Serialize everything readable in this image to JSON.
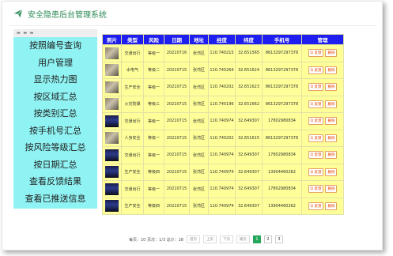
{
  "app": {
    "title": "安全隐患后台管理系统",
    "icon": "paper-plane-icon",
    "accent": "#2e8b57"
  },
  "sidebar": {
    "menu_icon": "menu-icon",
    "items": [
      "按照编号查询",
      "用户管理",
      "显示热力图",
      "按区域汇总",
      "按类别汇总",
      "按手机号汇总",
      "按风险等级汇总",
      "按日期汇总",
      "查看反馈结果",
      "查看已推送信息"
    ]
  },
  "table": {
    "headers": [
      "照片",
      "类型",
      "风险",
      "日期",
      "地址",
      "经度",
      "纬度",
      "手机号",
      "管理"
    ],
    "rows": [
      {
        "photo": "photo-default",
        "type": "交通出行",
        "risk": "等级一",
        "date": "20210716",
        "addr": "张湾区",
        "lng": "110.740215",
        "lat": "32.651565",
        "phone": "8613297297378"
      },
      {
        "photo": "photo-default",
        "type": "水电气",
        "risk": "等级二",
        "date": "20210715",
        "addr": "张湾区",
        "lng": "110.740264",
        "lat": "32.651624",
        "phone": "8613297297378"
      },
      {
        "photo": "photo-default",
        "type": "生产安全",
        "risk": "等级一",
        "date": "20210715",
        "addr": "张湾区",
        "lng": "110.740202",
        "lat": "32.651623",
        "phone": "8613297297378"
      },
      {
        "photo": "photo-default",
        "type": "火灾防爆",
        "risk": "等级三",
        "date": "20210715",
        "addr": "张湾区",
        "lng": "110.740196",
        "lat": "32.651662",
        "phone": "8613297297378"
      },
      {
        "photo": "photo-dark",
        "type": "交通出行",
        "risk": "等级一",
        "date": "20210715",
        "addr": "张湾区",
        "lng": "110.740974",
        "lat": "32.649307",
        "phone": "17802980834"
      },
      {
        "photo": "photo-default",
        "type": "人身安全",
        "risk": "等级一",
        "date": "20210715",
        "addr": "张湾区",
        "lng": "110.740202",
        "lat": "32.651615",
        "phone": "8613297297378"
      },
      {
        "photo": "photo-dark",
        "type": "交通出行",
        "risk": "等级一",
        "date": "20210715",
        "addr": "张湾区",
        "lng": "110.740974",
        "lat": "32.649307",
        "phone": "17802980834"
      },
      {
        "photo": "photo-dark",
        "type": "生产安全",
        "risk": "等级四",
        "date": "20210715",
        "addr": "张湾区",
        "lng": "110.740974",
        "lat": "32.649307",
        "phone": "13904460262"
      },
      {
        "photo": "photo-dark",
        "type": "交通出行",
        "risk": "等级一",
        "date": "20210715",
        "addr": "张湾区",
        "lng": "110.740974",
        "lat": "32.649307",
        "phone": "17802980834"
      },
      {
        "photo": "photo-dark",
        "type": "生产安全",
        "risk": "等级四",
        "date": "20210715",
        "addr": "张湾区",
        "lng": "110.740974",
        "lat": "32.649307",
        "phone": "13904460262"
      }
    ],
    "action_labels": [
      "Q 反馈",
      "删除"
    ],
    "action_icons": [
      "search-icon",
      "delete-icon"
    ]
  },
  "pager": {
    "info": "每页：10 页次：1/3 总计：28",
    "buttons": [
      "首页",
      "上页",
      "下页",
      "尾页"
    ],
    "pages": [
      "1",
      "2",
      "3"
    ],
    "current": "1"
  }
}
